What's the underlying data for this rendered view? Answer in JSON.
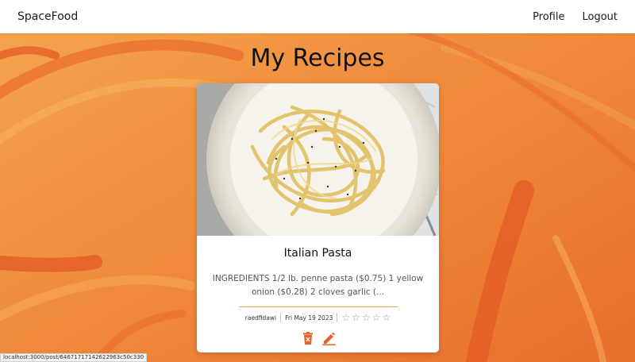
{
  "nav": {
    "brand": "SpaceFood",
    "links": [
      "Profile",
      "Logout"
    ]
  },
  "page": {
    "title": "My Recipes"
  },
  "recipes": [
    {
      "title": "Italian Pasta",
      "description": "INGREDIENTS 1/2 lb. penne pasta ($0.75) 1 yellow onion ($0.28) 2 cloves garlic (...",
      "author": "raedfidawi",
      "date": "Fri May 19 2023",
      "rating": 0,
      "rating_max": 5,
      "image_icon": "pasta-photo",
      "actions": [
        "trash-icon",
        "pencil-icon"
      ]
    }
  ],
  "status_bar": {
    "url": "localhost:3000/post/64671717142622963c50c330"
  },
  "colors": {
    "background": "#f08a3a",
    "accent": "#e8612c",
    "card": "#ffffff",
    "divider": "#f0a04a"
  }
}
